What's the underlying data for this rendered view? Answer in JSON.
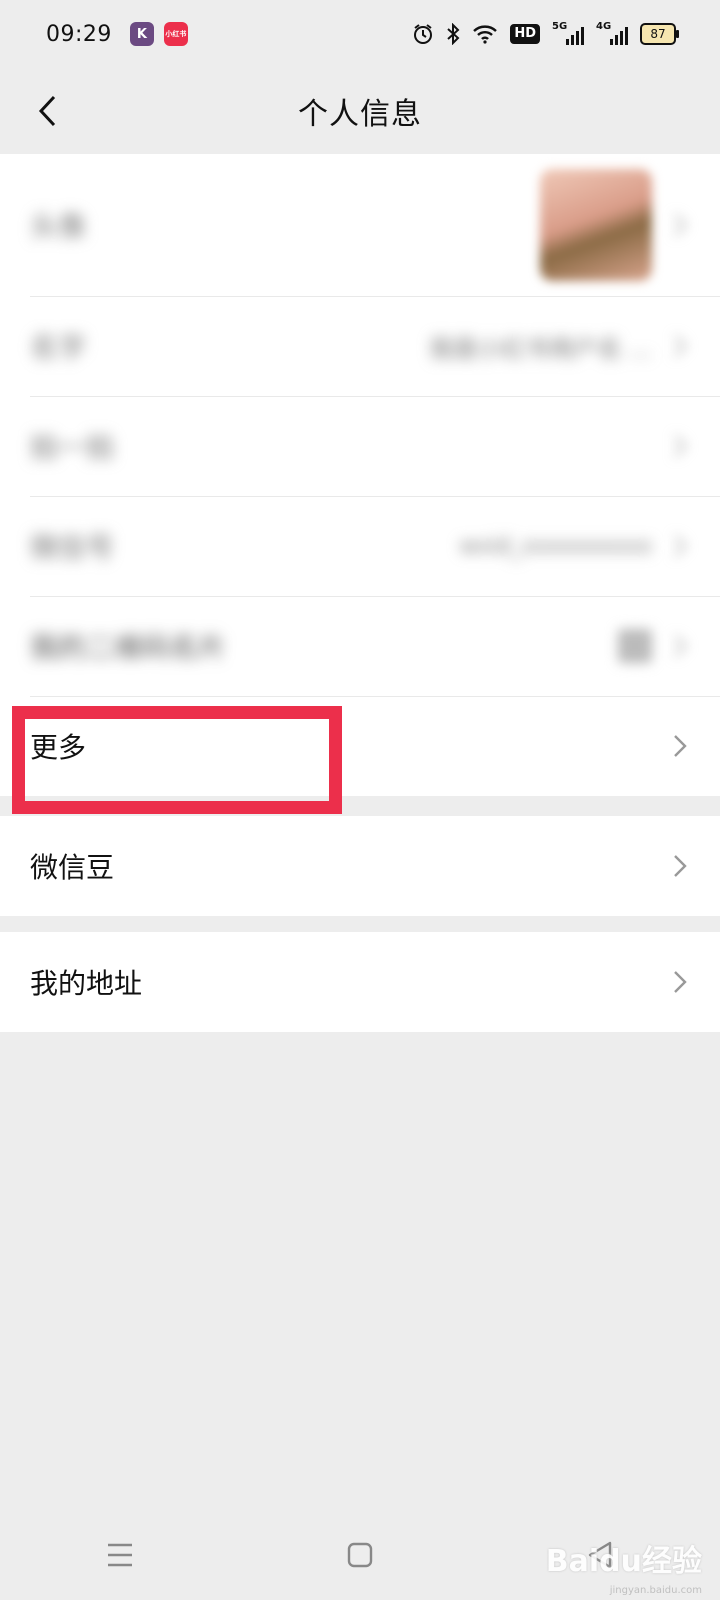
{
  "status_bar": {
    "time": "09:29",
    "app_k": "K",
    "app_red": "小红书",
    "hd": "HD",
    "net1": "5G",
    "net2": "4G",
    "battery": "87"
  },
  "nav": {
    "title": "个人信息",
    "back_icon": "back-chevron-icon"
  },
  "group1": {
    "rows": [
      {
        "label": "头像",
        "value": ""
      },
      {
        "label": "名字",
        "value": "我是小红书用户名 ..."
      },
      {
        "label": "拍一拍",
        "value": ""
      },
      {
        "label": "微信号",
        "value": "wxid_xxxxxxxxxx"
      },
      {
        "label": "我的二维码名片",
        "partial_label": "名片",
        "value": ""
      },
      {
        "label": "更多",
        "value": ""
      }
    ]
  },
  "group2": {
    "label": "微信豆"
  },
  "group3": {
    "label": "我的地址"
  },
  "watermark": {
    "text": "Baidu经验",
    "sub": "jingyan.baidu.com"
  },
  "colors": {
    "highlight": "#ec2f4b",
    "background": "#ededed"
  }
}
